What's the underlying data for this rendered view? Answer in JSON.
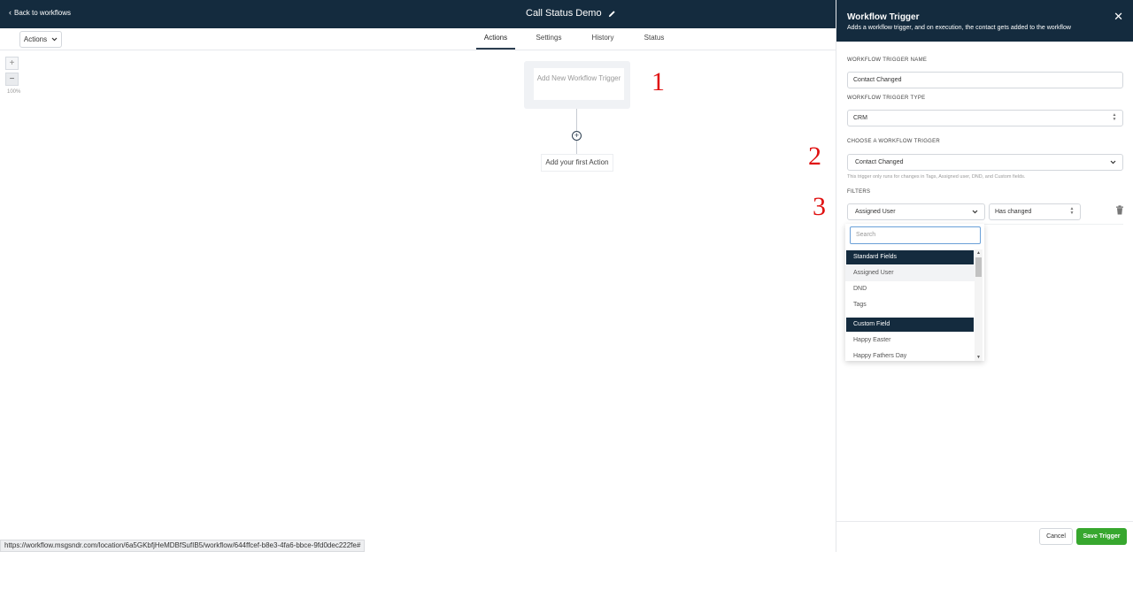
{
  "header": {
    "back_label": "Back to workflows",
    "title": "Call Status Demo"
  },
  "toolbar": {
    "actions_label": "Actions"
  },
  "tabs": [
    {
      "label": "Actions",
      "active": true
    },
    {
      "label": "Settings",
      "active": false
    },
    {
      "label": "History",
      "active": false
    },
    {
      "label": "Status",
      "active": false
    }
  ],
  "zoom": {
    "plus": "+",
    "minus": "−",
    "level": "100%"
  },
  "canvas": {
    "trigger_label": "Add New Workflow Trigger",
    "add_symbol": "+",
    "first_action_label": "Add your first Action"
  },
  "annotations": [
    "1",
    "2",
    "3"
  ],
  "status_url": "https://workflow.msgsndr.com/location/6a5GKbfjHeMDBfSufIB5/workflow/644ffcef-b8e3-4fa6-bbce-9fd0dec222fe#",
  "panel": {
    "title": "Workflow Trigger",
    "subtitle": "Adds a workflow trigger, and on execution, the contact gets added to the workflow",
    "close_symbol": "✕",
    "name_label": "WORKFLOW TRIGGER NAME",
    "name_value": "Contact Changed",
    "type_label": "WORKFLOW TRIGGER TYPE",
    "type_value": "CRM",
    "choose_label": "CHOOSE A WORKFLOW TRIGGER",
    "choose_value": "Contact Changed",
    "choose_hint": "This trigger only runs for changes in Tags, Assigned user, DND, and Custom fields.",
    "filters_label": "FILTERS",
    "filter_field": "Assigned User",
    "filter_operator": "Has changed",
    "cancel_label": "Cancel",
    "save_label": "Save Trigger"
  },
  "dropdown": {
    "search_placeholder": "Search",
    "groups": [
      {
        "name": "Standard Fields",
        "items": [
          "Assigned User",
          "DND",
          "Tags"
        ]
      },
      {
        "name": "Custom Field",
        "items": [
          "Happy Easter",
          "Happy Fathers Day"
        ]
      }
    ]
  },
  "colors": {
    "navy": "#142b3e",
    "save_green": "#37a72e",
    "annotation_red": "#e01010"
  }
}
